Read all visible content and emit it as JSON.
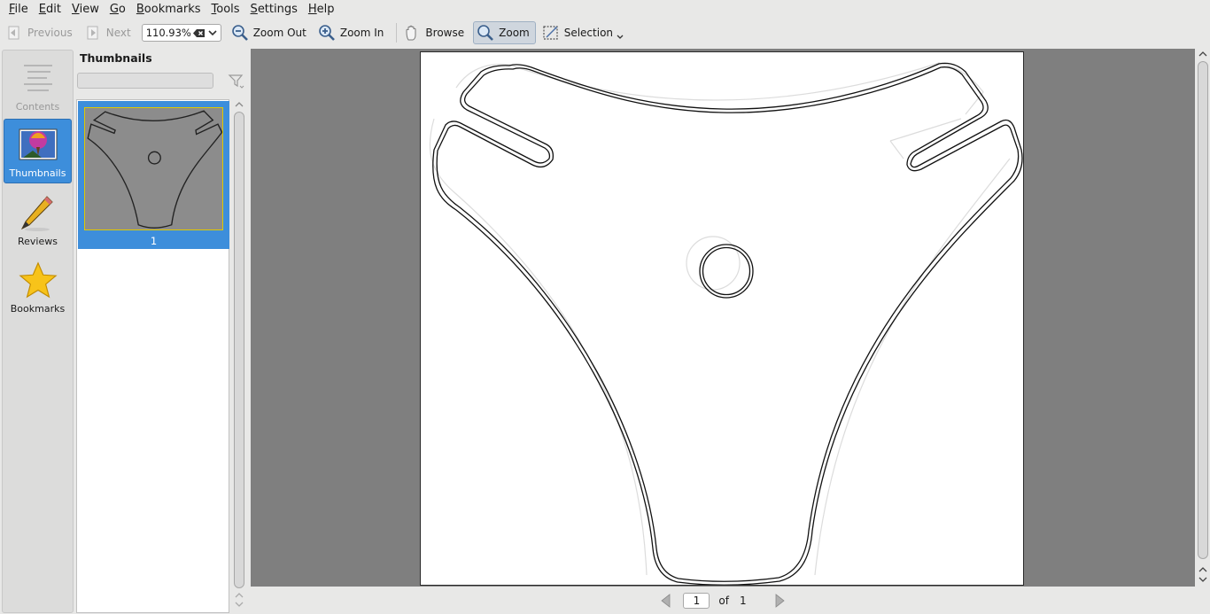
{
  "menu": {
    "items": [
      {
        "mnemonic": "F",
        "rest": "ile"
      },
      {
        "mnemonic": "E",
        "rest": "dit"
      },
      {
        "mnemonic": "V",
        "rest": "iew"
      },
      {
        "mnemonic": "G",
        "rest": "o"
      },
      {
        "mnemonic": "B",
        "rest": "ookmarks"
      },
      {
        "mnemonic": "T",
        "rest": "ools"
      },
      {
        "mnemonic": "S",
        "rest": "ettings"
      },
      {
        "mnemonic": "H",
        "rest": "elp"
      }
    ]
  },
  "toolbar": {
    "previous_label": "Previous",
    "next_label": "Next",
    "zoom_value": "110.93%",
    "zoom_out_label": "Zoom Out",
    "zoom_in_label": "Zoom In",
    "browse_label": "Browse",
    "zoom_tool_label": "Zoom",
    "selection_label": "Selection"
  },
  "side_tabs": {
    "contents": "Contents",
    "thumbnails": "Thumbnails",
    "reviews": "Reviews",
    "bookmarks": "Bookmarks",
    "selected": "thumbnails"
  },
  "thumbnails_panel": {
    "title": "Thumbnails",
    "search_value": "",
    "items": [
      {
        "page_number": "1"
      }
    ]
  },
  "document": {
    "current_page": "1",
    "of_label": "of",
    "total_pages": "1"
  },
  "colors": {
    "accent": "#3d8edb",
    "viewport_bg": "#7f7f7f",
    "thumbnail_highlight": "#e0c900"
  },
  "icons": {
    "previous": "previous-page-icon",
    "next": "next-page-icon",
    "zoom_out": "zoom-out-icon",
    "zoom_in": "zoom-in-icon",
    "browse": "hand-icon",
    "zoom": "magnifier-icon",
    "selection": "selection-icon",
    "contents": "contents-icon",
    "thumbnails": "thumbnails-icon",
    "reviews": "pencil-icon",
    "bookmarks": "star-icon",
    "filter": "filter-icon"
  }
}
